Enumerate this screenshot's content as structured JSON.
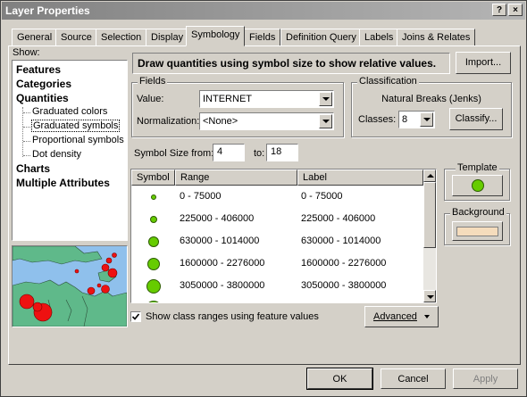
{
  "window": {
    "title": "Layer Properties",
    "help_btn": "?",
    "close_btn": "×"
  },
  "tabs": [
    {
      "label": "General"
    },
    {
      "label": "Source"
    },
    {
      "label": "Selection"
    },
    {
      "label": "Display"
    },
    {
      "label": "Symbology"
    },
    {
      "label": "Fields"
    },
    {
      "label": "Definition Query"
    },
    {
      "label": "Labels"
    },
    {
      "label": "Joins & Relates"
    }
  ],
  "active_tab": "Symbology",
  "show": {
    "label": "Show:",
    "items": {
      "features": "Features",
      "categories": "Categories",
      "quantities": "Quantities",
      "graduated_colors": "Graduated colors",
      "graduated_symbols": "Graduated symbols",
      "proportional_symbols": "Proportional symbols",
      "dot_density": "Dot density",
      "charts": "Charts",
      "multiple_attributes": "Multiple Attributes"
    },
    "selected": "Graduated symbols"
  },
  "description": "Draw quantities using symbol size to show relative values.",
  "import_button": "Import...",
  "fields": {
    "legend": "Fields",
    "value_label": "Value:",
    "value": "INTERNET",
    "normalization_label": "Normalization:",
    "normalization": "<None>"
  },
  "classification": {
    "legend": "Classification",
    "method": "Natural Breaks (Jenks)",
    "classes_label": "Classes:",
    "classes": "8",
    "classify_button": "Classify..."
  },
  "symbol_size": {
    "from_label": "Symbol Size from:",
    "from": "4",
    "to_label": "to:",
    "to": "18"
  },
  "table": {
    "headers": {
      "symbol": "Symbol",
      "range": "Range",
      "label": "Label"
    },
    "rows": [
      {
        "range": "0 - 75000",
        "label": "0 - 75000"
      },
      {
        "range": "225000 - 406000",
        "label": "225000 - 406000"
      },
      {
        "range": "630000 - 1014000",
        "label": "630000 - 1014000"
      },
      {
        "range": "1600000 - 2276000",
        "label": "1600000 - 2276000"
      },
      {
        "range": "3050000 - 3800000",
        "label": "3050000 - 3800000"
      }
    ]
  },
  "template": {
    "label": "Template",
    "color": "#66cc00"
  },
  "background": {
    "label": "Background",
    "color": "#f5dcbc"
  },
  "show_class_ranges": {
    "label": "Show class ranges using feature values",
    "checked": true
  },
  "advanced_button": "Advanced",
  "footer": {
    "ok": "OK",
    "cancel": "Cancel",
    "apply": "Apply"
  },
  "colors": {
    "symbol_fill": "#66cc00",
    "map_water": "#8fc0ec",
    "map_land": "#5fb98a",
    "map_point": "#ee1111"
  }
}
